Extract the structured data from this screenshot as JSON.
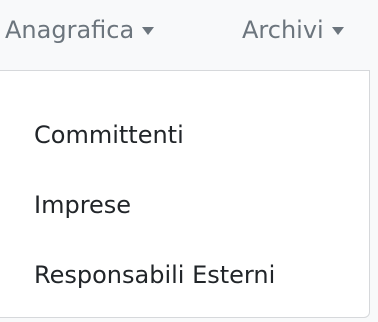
{
  "navbar": {
    "items": [
      {
        "label": "Anagrafica",
        "icon": "caret-down-icon"
      },
      {
        "label": "Archivi",
        "icon": "caret-down-icon"
      }
    ]
  },
  "dropdown": {
    "items": [
      {
        "label": "Committenti"
      },
      {
        "label": "Imprese"
      },
      {
        "label": "Responsabili Esterni"
      }
    ]
  },
  "colors": {
    "nav_text": "#6c757d",
    "item_text": "#212529",
    "menu_bg": "#ffffff",
    "navbar_bg": "#f8f9fa",
    "menu_border": "#d6d8db"
  }
}
